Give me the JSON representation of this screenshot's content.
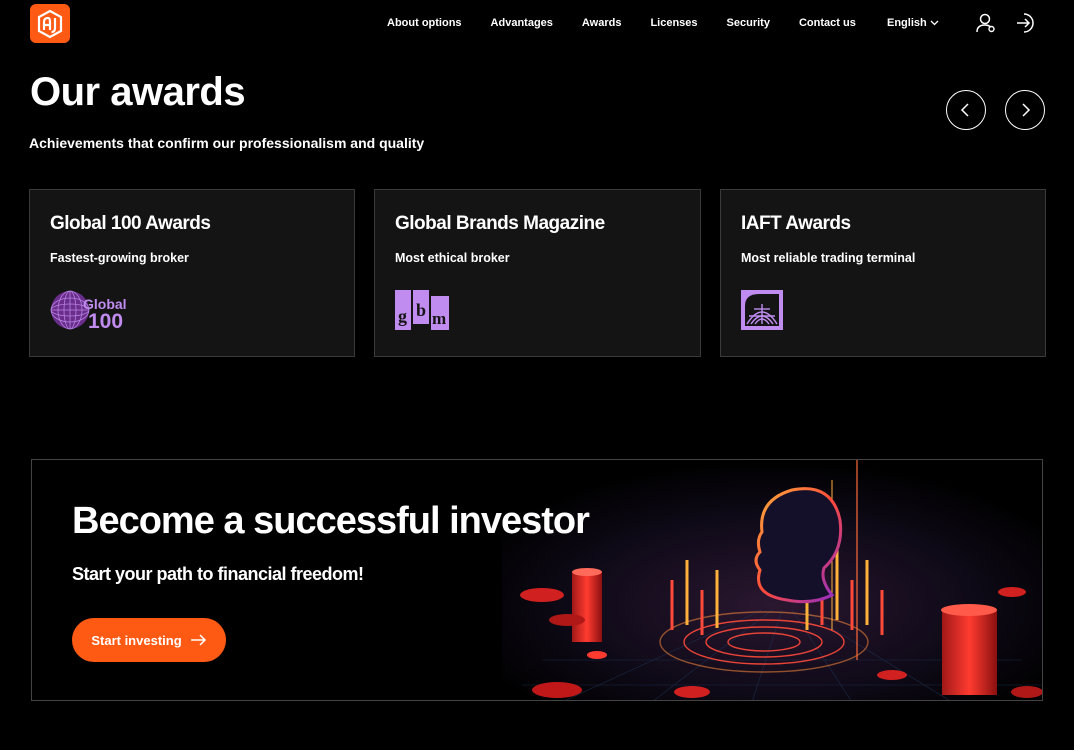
{
  "header": {
    "logo_icon": "aj-logo-icon",
    "nav": [
      {
        "label": "About options"
      },
      {
        "label": "Advantages"
      },
      {
        "label": "Awards"
      },
      {
        "label": "Licenses"
      },
      {
        "label": "Security"
      },
      {
        "label": "Contact us"
      }
    ],
    "language": "English",
    "icons": [
      "user-icon",
      "login-icon",
      "chevron-down-icon"
    ]
  },
  "awards": {
    "title": "Our awards",
    "subtitle": "Achievements that confirm our professionalism and quality",
    "controls": [
      "arrow-left-icon",
      "arrow-right-icon"
    ],
    "cards": [
      {
        "title": "Global 100 Awards",
        "subtitle": "Fastest-growing broker",
        "logo_icon": "global-100-logo",
        "logo_text_1": "Global",
        "logo_text_2": "100"
      },
      {
        "title": "Global Brands Magazine",
        "subtitle": "Most ethical broker",
        "logo_icon": "gbm-logo",
        "logo_text": "gbm"
      },
      {
        "title": "IAFT Awards",
        "subtitle": "Most reliable trading terminal",
        "logo_icon": "iaft-logo"
      }
    ]
  },
  "banner": {
    "title": "Become a successful investor",
    "subtitle": "Start your path to financial freedom!",
    "button_label": "Start investing",
    "button_icon": "arrow-right-icon",
    "image": "investor-head-illustration"
  },
  "colors": {
    "accent": "#ff5a14",
    "logo_purple": "#c08cf0",
    "card_bg": "#141414",
    "background": "#000000"
  }
}
